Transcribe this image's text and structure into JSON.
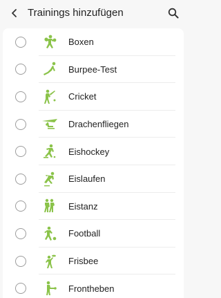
{
  "header": {
    "title": "Trainings hinzufügen",
    "back_icon": "back-arrow-icon",
    "search_icon": "search-icon"
  },
  "colors": {
    "accent_green": "#8bc34a",
    "background": "#f7f7f7"
  },
  "items": [
    {
      "label": "Boxen",
      "icon": "boxing-icon",
      "checked": false
    },
    {
      "label": "Burpee-Test",
      "icon": "burpee-icon",
      "checked": false
    },
    {
      "label": "Cricket",
      "icon": "cricket-icon",
      "checked": false
    },
    {
      "label": "Drachenfliegen",
      "icon": "hang-glider-icon",
      "checked": false
    },
    {
      "label": "Eishockey",
      "icon": "ice-hockey-icon",
      "checked": false
    },
    {
      "label": "Eislaufen",
      "icon": "ice-skating-icon",
      "checked": false
    },
    {
      "label": "Eistanz",
      "icon": "ice-dance-icon",
      "checked": false
    },
    {
      "label": "Football",
      "icon": "football-icon",
      "checked": false
    },
    {
      "label": "Frisbee",
      "icon": "frisbee-icon",
      "checked": false
    },
    {
      "label": "Frontheben",
      "icon": "front-raise-icon",
      "checked": false
    }
  ]
}
